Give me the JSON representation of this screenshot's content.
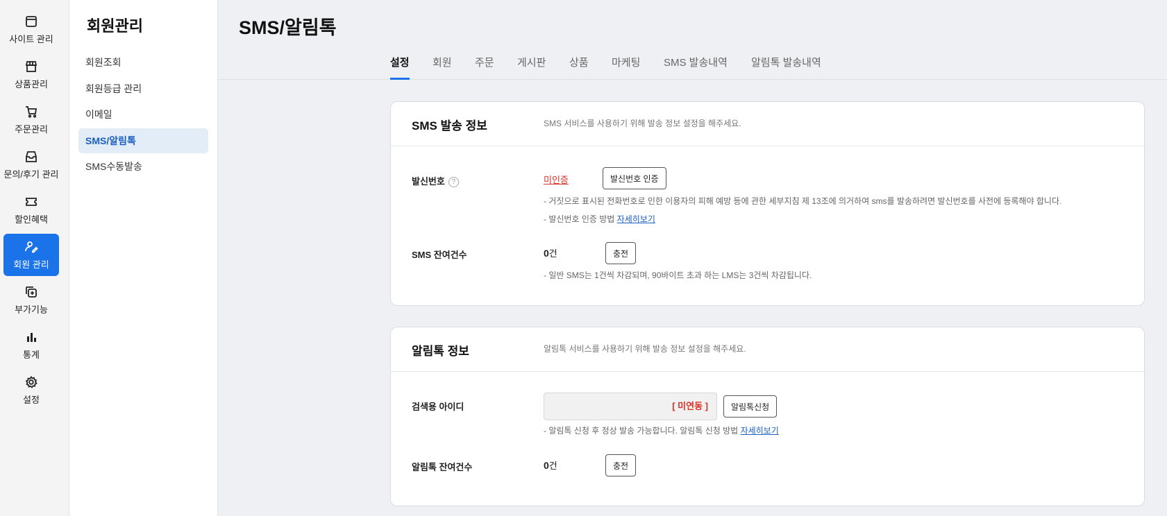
{
  "rail": {
    "items": [
      {
        "label": "사이트 관리",
        "icon": "window-icon"
      },
      {
        "label": "상품관리",
        "icon": "store-icon"
      },
      {
        "label": "주문관리",
        "icon": "cart-icon"
      },
      {
        "label": "문의/후기 관리",
        "icon": "inbox-icon"
      },
      {
        "label": "할인혜택",
        "icon": "ticket-icon"
      },
      {
        "label": "회원 관리",
        "icon": "user-edit-icon"
      },
      {
        "label": "부가기능",
        "icon": "add-copy-icon"
      },
      {
        "label": "통계",
        "icon": "bar-chart-icon"
      },
      {
        "label": "설정",
        "icon": "gear-icon"
      }
    ],
    "active_color": "#1a73e8"
  },
  "submenu": {
    "title": "회원관리",
    "items": [
      "회원조회",
      "회원등급 관리",
      "이메일",
      "SMS/알림톡",
      "SMS수동발송"
    ]
  },
  "page": {
    "title": "SMS/알림톡",
    "tabs": [
      "설정",
      "회원",
      "주문",
      "게시판",
      "상품",
      "마케팅",
      "SMS 발송내역",
      "알림톡 발송내역"
    ]
  },
  "sms_card": {
    "title": "SMS 발송 정보",
    "desc": "SMS 서비스를 사용하기 위해 발송 정보 설정을 해주세요.",
    "sender_label": "발신번호",
    "help_glyph": "?",
    "sender_status": "미인증",
    "sender_button": "발신번호 인증",
    "note1": "-  거짓으로 표시된 전화번호로 인한 이용자의 피해 예방 등에 관한 세부지침 제 13조에 의거하여 sms를 발송하려면 발신번호를 사전에 등록해야 합니다.",
    "note2_prefix": "-  발신번호 인증 방법 ",
    "note2_link": "자세히보기",
    "remain_label": "SMS 잔여건수",
    "remain_value": "0",
    "remain_unit": "건",
    "charge_button": "충전",
    "note3": "-  일반 SMS는 1건씩 차감되며, 90바이트 초과 하는 LMS는 3건씩 차감됩니다."
  },
  "alimtalk_card": {
    "title": "알림톡 정보",
    "desc": "알림톡 서비스를 사용하기 위해 발송 정보 설정을 해주세요.",
    "search_id_label": "검색용 아이디",
    "search_id_status": "[ 미연동 ]",
    "apply_button": "알림톡신청",
    "note_prefix": "-  알림톡 신청 후 정상 발송 가능합니다. 알림톡 신청 방법 ",
    "note_link": "자세히보기",
    "remain_label": "알림톡 잔여건수",
    "remain_value": "0",
    "remain_unit": "건",
    "charge_button": "충전"
  }
}
